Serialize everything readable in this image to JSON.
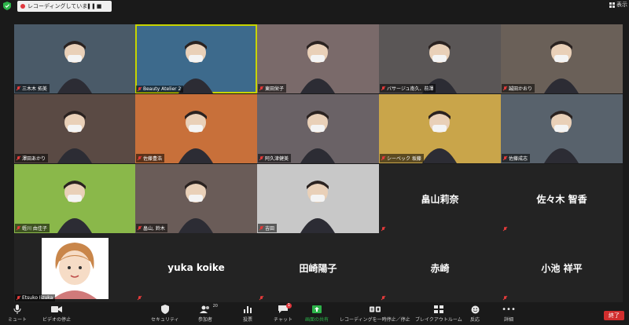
{
  "topbar": {
    "recording_text": "レコーディングしています...",
    "view_label": "表示"
  },
  "tiles": [
    {
      "name": "三木木 拓美",
      "bg": "#4a5a68"
    },
    {
      "name": "Beauty Atelier 2",
      "bg": "#3d6a8c",
      "active": true
    },
    {
      "name": "東田栄子",
      "bg": "#7a6a6a"
    },
    {
      "name": "バサージュ南久、前澤",
      "bg": "#5a5656"
    },
    {
      "name": "誠田かおり",
      "bg": "#6a6058"
    },
    {
      "name": "澤田あかり",
      "bg": "#5a4a44"
    },
    {
      "name": "佐藤豊浩",
      "bg": "#c8703a"
    },
    {
      "name": "阿久津健美",
      "bg": "#6a6266"
    },
    {
      "name": "シーベック 坂藤",
      "bg": "#c9a54a"
    },
    {
      "name": "佐藤成志",
      "bg": "#58626c"
    },
    {
      "name": "蛭川 由佳子",
      "bg": "#8ab84a"
    },
    {
      "name": "畠山, 鈴木",
      "bg": "#6a5c58"
    },
    {
      "name": "吉田",
      "bg": "#c8c8c8"
    },
    {
      "name": "畠山莉奈",
      "bg": "#232323",
      "big": true
    },
    {
      "name": "佐々木 智香",
      "bg": "#232323",
      "big": true
    },
    {
      "name": "Etsuko Iizuka",
      "bg": "#232323"
    },
    {
      "name": "yuka koike",
      "bg": "#232323",
      "big": true
    },
    {
      "name": "田崎陽子",
      "bg": "#232323",
      "big": true
    },
    {
      "name": "赤崎",
      "bg": "#232323",
      "big": true
    },
    {
      "name": "小池 祥平",
      "bg": "#232323",
      "big": true
    }
  ],
  "toolbar": {
    "mute": "ミュート",
    "video": "ビデオの停止",
    "security": "セキュリティ",
    "participants": "参加者",
    "participants_count": "20",
    "polls": "投票",
    "chat": "チャット",
    "chat_badge": "1",
    "share": "画面の共有",
    "recording": "レコーディングを一時停止／停止",
    "breakout": "ブレイクアウトルーム",
    "reactions": "反応",
    "more": "詳細",
    "end": "終了"
  }
}
